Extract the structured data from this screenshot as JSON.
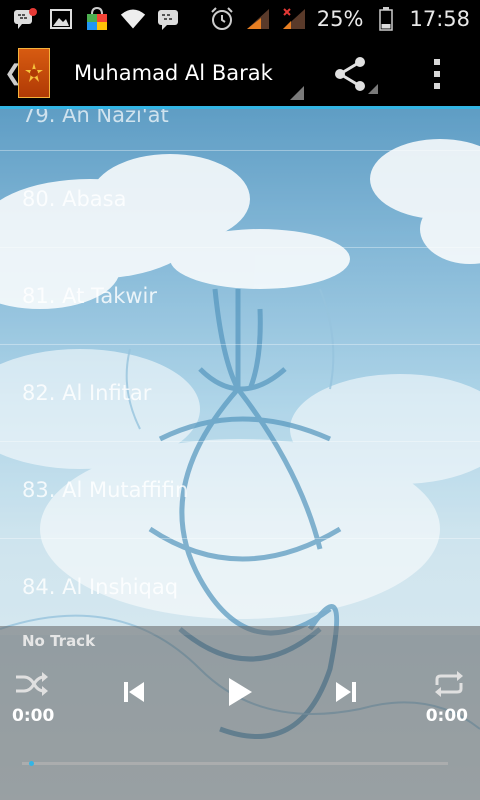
{
  "status_bar": {
    "battery_percent": "25%",
    "clock": "17:58",
    "icons": [
      "bbm-notification-icon",
      "image-icon",
      "shopping-bag-icon",
      "wifi-icon",
      "bbm-icon",
      "alarm-icon",
      "signal-icon",
      "signal-no-service-icon",
      "battery-icon"
    ]
  },
  "action_bar": {
    "title": "Muhamad Al Barak",
    "icons": [
      "back-chevron-icon",
      "app-logo-icon",
      "share-icon",
      "overflow-menu-icon"
    ]
  },
  "tracks": [
    {
      "label": "79. An Nazi'at"
    },
    {
      "label": "80. Abasa"
    },
    {
      "label": "81. At Takwir"
    },
    {
      "label": "82. Al Infitar"
    },
    {
      "label": "83. Al Mutaffifin"
    },
    {
      "label": "84. Al Inshiqaq"
    }
  ],
  "player": {
    "now_playing": "No Track",
    "elapsed": "0:00",
    "duration": "0:00",
    "progress": 0.0,
    "icons": [
      "shuffle-icon",
      "previous-icon",
      "play-icon",
      "next-icon",
      "repeat-icon"
    ]
  },
  "colors": {
    "accent": "#33b5e5",
    "status_bar_bg": "#000000",
    "action_bar_bg": "#000000"
  }
}
